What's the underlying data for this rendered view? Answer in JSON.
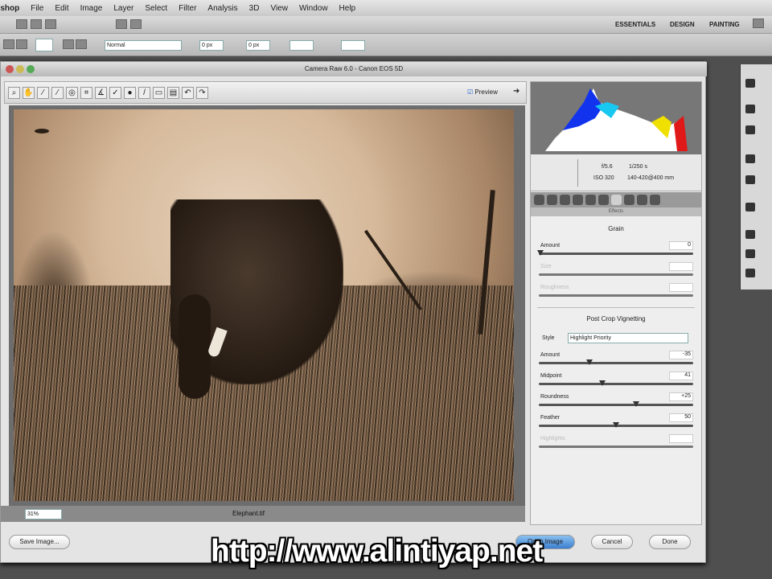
{
  "menu": [
    "Photoshop",
    "File",
    "Edit",
    "Image",
    "Layer",
    "Select",
    "Filter",
    "Analysis",
    "3D",
    "View",
    "Window",
    "Help"
  ],
  "workspaces": [
    "ESSENTIALS",
    "DESIGN",
    "PAINTING"
  ],
  "options": {
    "style": "Normal",
    "w": "0 px",
    "h": "0 px"
  },
  "dialog": {
    "title": "Camera Raw 6.0  -  Canon EOS 5D",
    "preview_label": "Preview",
    "zoom": "31%",
    "status": "Elephant.tif"
  },
  "info": {
    "aperture": "f/5.6",
    "shutter": "1/250 s",
    "iso": "ISO 320",
    "lens": "140-420@400 mm"
  },
  "panel": {
    "header": "Effects",
    "grain": {
      "title": "Grain",
      "amount_label": "Amount",
      "amount": "0",
      "size_label": "Size",
      "roughness_label": "Roughness"
    },
    "vignette": {
      "title": "Post Crop Vignetting",
      "style_label": "Style",
      "style_value": "Highlight Priority",
      "sliders": [
        {
          "label": "Amount",
          "value": "-35",
          "pos": 0.33
        },
        {
          "label": "Midpoint",
          "value": "41",
          "pos": 0.41
        },
        {
          "label": "Roundness",
          "value": "+25",
          "pos": 0.63
        },
        {
          "label": "Feather",
          "value": "50",
          "pos": 0.5
        },
        {
          "label": "Highlights",
          "value": "",
          "pos": 0,
          "disabled": true
        }
      ]
    }
  },
  "buttons": {
    "save": "Save Image...",
    "open": "Open Image",
    "cancel": "Cancel",
    "done": "Done"
  },
  "watermark": "http://www.alintiyap.net"
}
